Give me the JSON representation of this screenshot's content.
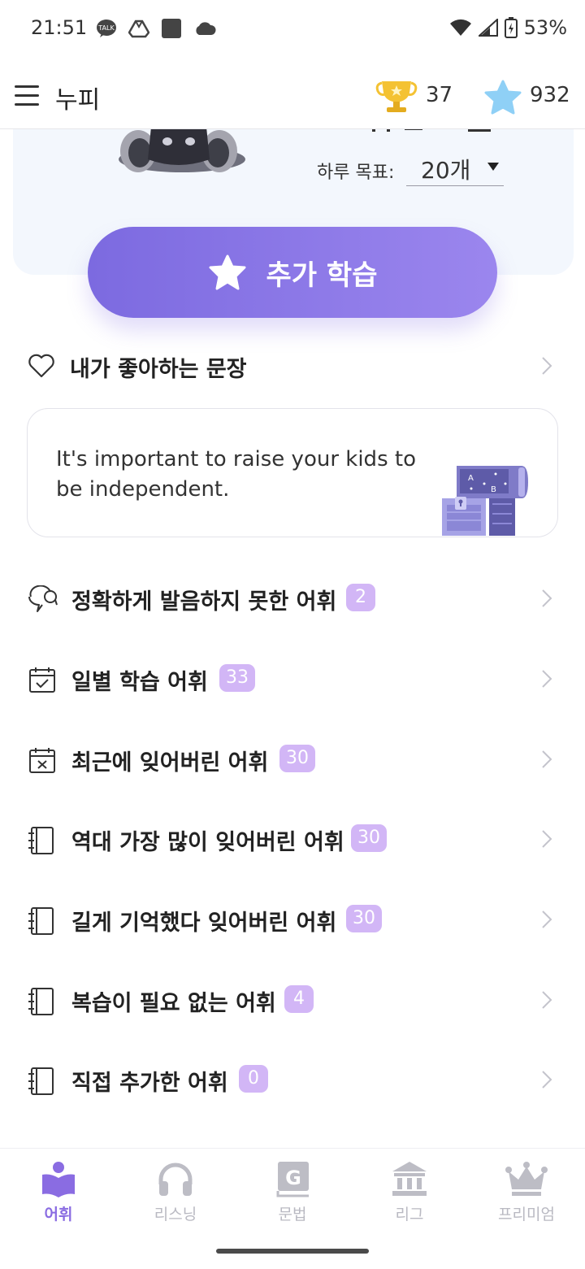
{
  "status_bar": {
    "time": "21:51",
    "battery": "53%",
    "left_icons": [
      "talk-icon",
      "drive-icon",
      "square-icon",
      "cloud-icon"
    ],
    "right_icons": [
      "wifi-icon",
      "signal-icon",
      "battery-icon"
    ]
  },
  "app_bar": {
    "title": "누피",
    "trophy_count": "37",
    "star_count": "932"
  },
  "hero": {
    "goal_label": "하루 목표:",
    "goal_value": "20개"
  },
  "extra_study": {
    "label": "추가 학습"
  },
  "favorites": {
    "label": "내가 좋아하는 문장"
  },
  "sentence_card": {
    "text": "It's important to raise your kids to be independent."
  },
  "vocab_lists": [
    {
      "label": "정확하게 발음하지 못한 어휘",
      "count": "2"
    },
    {
      "label": "일별 학습 어휘",
      "count": "33"
    },
    {
      "label": "최근에 잊어버린 어휘",
      "count": "30"
    },
    {
      "label": "역대 가장 많이 잊어버린 어휘",
      "count": "30"
    },
    {
      "label": "길게 기억했다 잊어버린 어휘",
      "count": "30"
    },
    {
      "label": "복습이 필요 없는 어휘",
      "count": "4"
    },
    {
      "label": "직접 추가한 어휘",
      "count": "0"
    }
  ],
  "bottom_nav": [
    {
      "label": "어휘",
      "active": true
    },
    {
      "label": "리스닝"
    },
    {
      "label": "문법"
    },
    {
      "label": "리그"
    },
    {
      "label": "프리미엄"
    }
  ],
  "colors": {
    "accent": "#8a6ce2",
    "badge": "#d2b6f6",
    "hero_bg": "#f3f7fd"
  }
}
